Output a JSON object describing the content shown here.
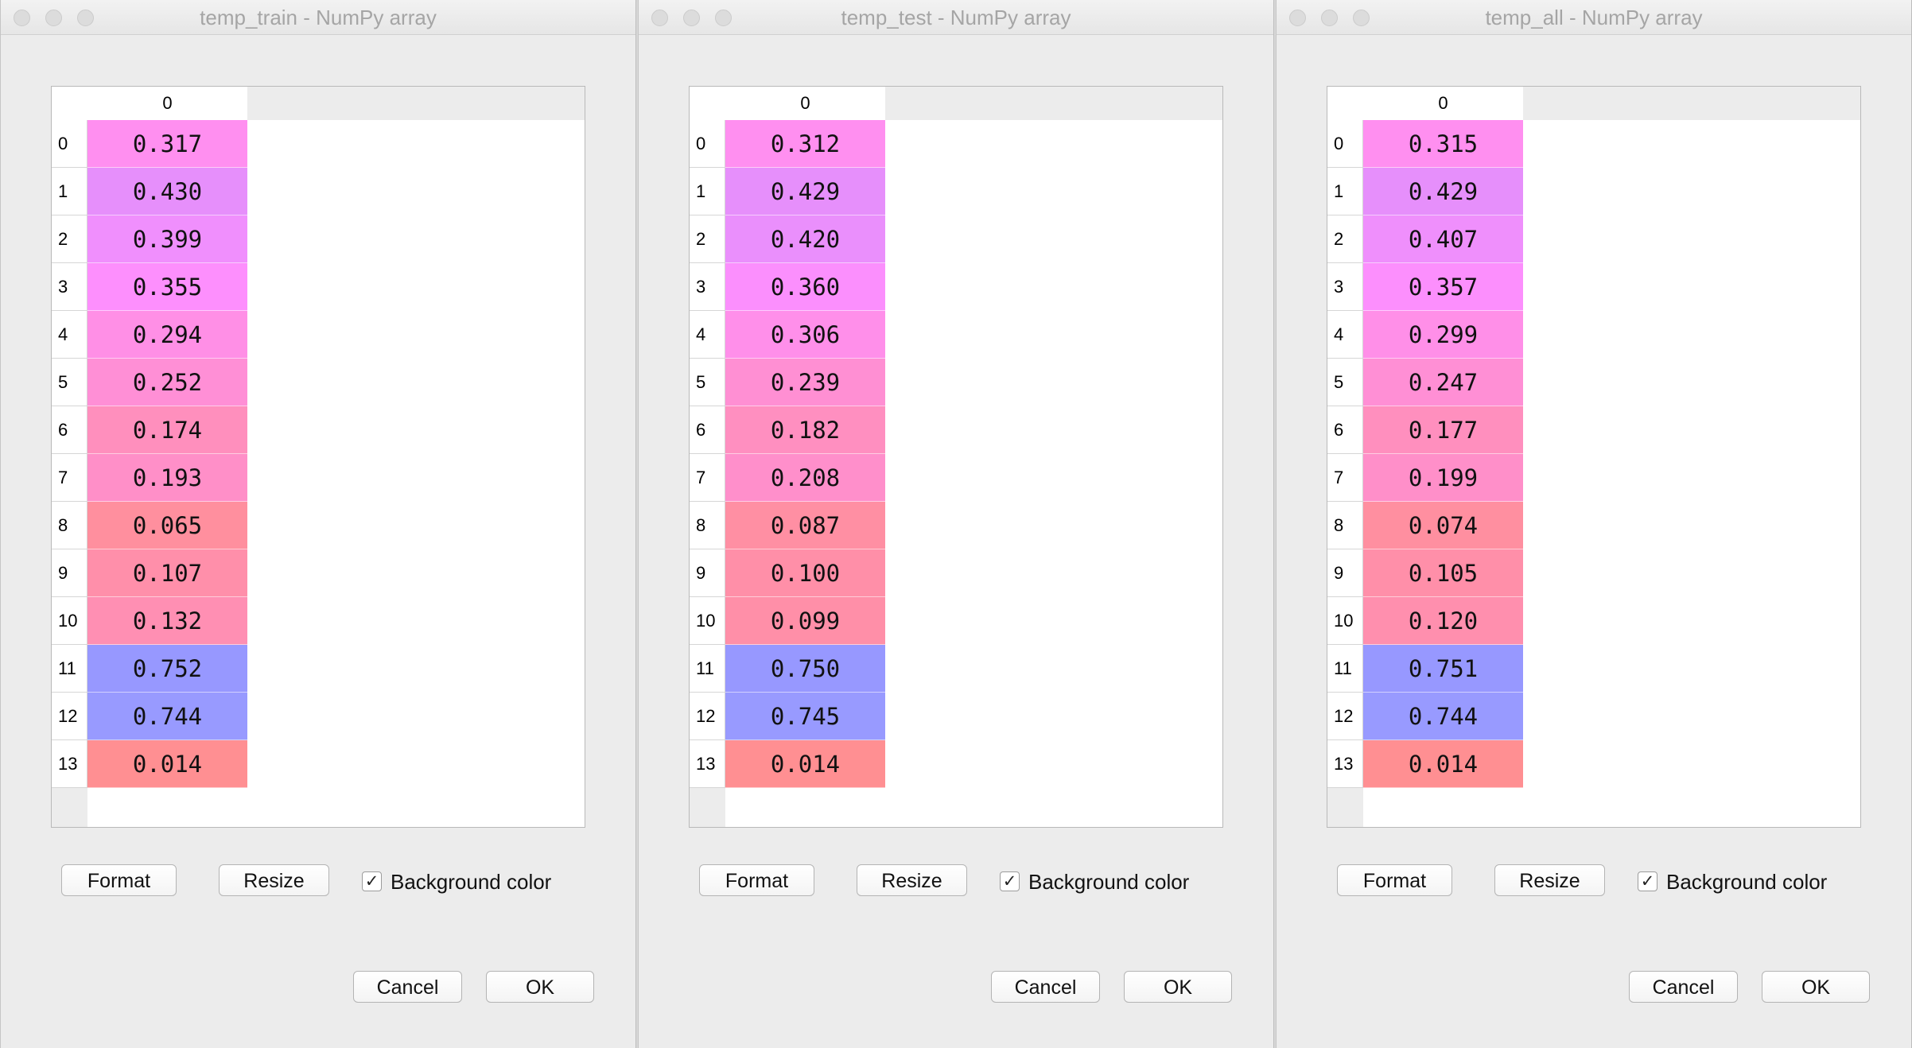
{
  "windows": [
    {
      "title": "temp_train - NumPy array",
      "column_header": "0",
      "rows": [
        {
          "index": "0",
          "value": "0.317",
          "color": "#ff8ff0"
        },
        {
          "index": "1",
          "value": "0.430",
          "color": "#e68ffb"
        },
        {
          "index": "2",
          "value": "0.399",
          "color": "#f08ffd"
        },
        {
          "index": "3",
          "value": "0.355",
          "color": "#fd8ffd"
        },
        {
          "index": "4",
          "value": "0.294",
          "color": "#ff8fe6"
        },
        {
          "index": "5",
          "value": "0.252",
          "color": "#ff8fd6"
        },
        {
          "index": "6",
          "value": "0.174",
          "color": "#ff8fbd"
        },
        {
          "index": "7",
          "value": "0.193",
          "color": "#ff8fc8"
        },
        {
          "index": "8",
          "value": "0.065",
          "color": "#ff8f9e"
        },
        {
          "index": "9",
          "value": "0.107",
          "color": "#ff8faa"
        },
        {
          "index": "10",
          "value": "0.132",
          "color": "#ff8fb3"
        },
        {
          "index": "11",
          "value": "0.752",
          "color": "#9798ff"
        },
        {
          "index": "12",
          "value": "0.744",
          "color": "#989aff"
        },
        {
          "index": "13",
          "value": "0.014",
          "color": "#ff8f92"
        }
      ],
      "buttons": {
        "format": "Format",
        "resize": "Resize",
        "cancel": "Cancel",
        "ok": "OK"
      },
      "background_color": {
        "label": "Background color",
        "checked": true,
        "check_glyph": "✓"
      }
    },
    {
      "title": "temp_test - NumPy array",
      "column_header": "0",
      "rows": [
        {
          "index": "0",
          "value": "0.312",
          "color": "#ff8ff0"
        },
        {
          "index": "1",
          "value": "0.429",
          "color": "#e68ffb"
        },
        {
          "index": "2",
          "value": "0.420",
          "color": "#ea8ffc"
        },
        {
          "index": "3",
          "value": "0.360",
          "color": "#fb8ffd"
        },
        {
          "index": "4",
          "value": "0.306",
          "color": "#ff8fea"
        },
        {
          "index": "5",
          "value": "0.239",
          "color": "#ff8fd3"
        },
        {
          "index": "6",
          "value": "0.182",
          "color": "#ff8fc0"
        },
        {
          "index": "7",
          "value": "0.208",
          "color": "#ff8fcb"
        },
        {
          "index": "8",
          "value": "0.087",
          "color": "#ff8fa3"
        },
        {
          "index": "9",
          "value": "0.100",
          "color": "#ff8fa8"
        },
        {
          "index": "10",
          "value": "0.099",
          "color": "#ff8fa8"
        },
        {
          "index": "11",
          "value": "0.750",
          "color": "#9798ff"
        },
        {
          "index": "12",
          "value": "0.745",
          "color": "#989aff"
        },
        {
          "index": "13",
          "value": "0.014",
          "color": "#ff8f92"
        }
      ],
      "buttons": {
        "format": "Format",
        "resize": "Resize",
        "cancel": "Cancel",
        "ok": "OK"
      },
      "background_color": {
        "label": "Background color",
        "checked": true,
        "check_glyph": "✓"
      }
    },
    {
      "title": "temp_all - NumPy array",
      "column_header": "0",
      "rows": [
        {
          "index": "0",
          "value": "0.315",
          "color": "#ff8ff0"
        },
        {
          "index": "1",
          "value": "0.429",
          "color": "#e68ffb"
        },
        {
          "index": "2",
          "value": "0.407",
          "color": "#ef8ffc"
        },
        {
          "index": "3",
          "value": "0.357",
          "color": "#fc8ffd"
        },
        {
          "index": "4",
          "value": "0.299",
          "color": "#ff8fe8"
        },
        {
          "index": "5",
          "value": "0.247",
          "color": "#ff8fd5"
        },
        {
          "index": "6",
          "value": "0.177",
          "color": "#ff8fbe"
        },
        {
          "index": "7",
          "value": "0.199",
          "color": "#ff8fc9"
        },
        {
          "index": "8",
          "value": "0.074",
          "color": "#ff8fa0"
        },
        {
          "index": "9",
          "value": "0.105",
          "color": "#ff8fa9"
        },
        {
          "index": "10",
          "value": "0.120",
          "color": "#ff8fae"
        },
        {
          "index": "11",
          "value": "0.751",
          "color": "#9798ff"
        },
        {
          "index": "12",
          "value": "0.744",
          "color": "#989aff"
        },
        {
          "index": "13",
          "value": "0.014",
          "color": "#ff8f92"
        }
      ],
      "buttons": {
        "format": "Format",
        "resize": "Resize",
        "cancel": "Cancel",
        "ok": "OK"
      },
      "background_color": {
        "label": "Background color",
        "checked": true,
        "check_glyph": "✓"
      }
    }
  ]
}
